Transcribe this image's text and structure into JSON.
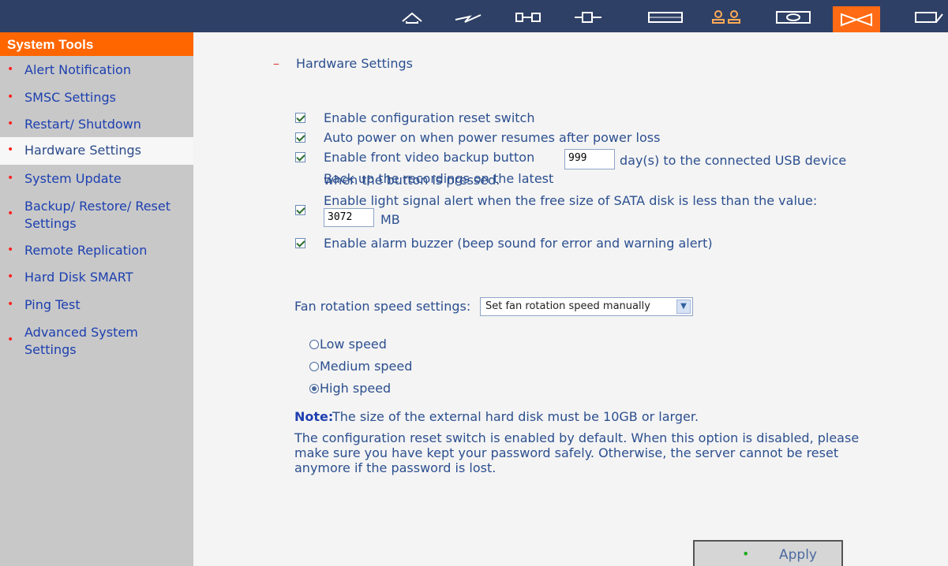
{
  "toolbar": {
    "icons": [
      "home-icon",
      "network-icon",
      "device-icon",
      "plugin-icon",
      "disk-icon",
      "users-icon",
      "share-icon",
      "system-tools-icon",
      "logout-icon"
    ],
    "active_index": 7,
    "colors": {
      "bar": "#2f4066",
      "active": "#ff6b14"
    }
  },
  "sidebar": {
    "header": "System Tools",
    "items": [
      {
        "label": "Alert Notification"
      },
      {
        "label": "SMSC Settings"
      },
      {
        "label": "Restart/ Shutdown"
      },
      {
        "label": "Hardware Settings",
        "active": true
      },
      {
        "label": "System Update"
      },
      {
        "label": "Backup/ Restore/ Reset Settings"
      },
      {
        "label": "Remote Replication"
      },
      {
        "label": "Hard Disk SMART"
      },
      {
        "label": "Ping Test"
      },
      {
        "label": "Advanced System Settings"
      }
    ]
  },
  "main": {
    "collapse_marker": "–",
    "section_title": "Hardware Settings",
    "options": {
      "reset_switch": {
        "label": "Enable configuration reset switch",
        "checked": true
      },
      "auto_power": {
        "label": "Auto power on when power resumes after power loss",
        "checked": true
      },
      "video_backup": {
        "label": "Enable front video backup button",
        "checked": true
      },
      "backup_text_before": "Back up the recordings on the latest",
      "backup_days_value": "999",
      "backup_text_after": "day(s) to the connected USB device",
      "backup_text_line2": "when the button is pressed.",
      "light_signal": {
        "label": "Enable light signal alert when the free size of SATA disk is less than the value:",
        "checked": true
      },
      "light_signal_value": "3072",
      "light_signal_unit": "MB",
      "alarm_buzzer": {
        "label": "Enable alarm buzzer (beep sound for error and warning alert)",
        "checked": true
      }
    },
    "fan": {
      "label": "Fan rotation speed settings:",
      "selected": "Set fan rotation speed manually",
      "speeds": [
        {
          "label": "Low speed",
          "selected": false
        },
        {
          "label": "Medium speed",
          "selected": false
        },
        {
          "label": "High speed",
          "selected": true
        }
      ]
    },
    "note_label": "Note:",
    "note_text": "The size of the external hard disk must be 10GB or larger.",
    "info_lines": [
      "The configuration reset switch is enabled by default. When this option is disabled, please",
      "make sure you have kept your password safely. Otherwise, the server cannot be reset",
      "anymore if the password is lost."
    ],
    "apply_label": "Apply"
  }
}
